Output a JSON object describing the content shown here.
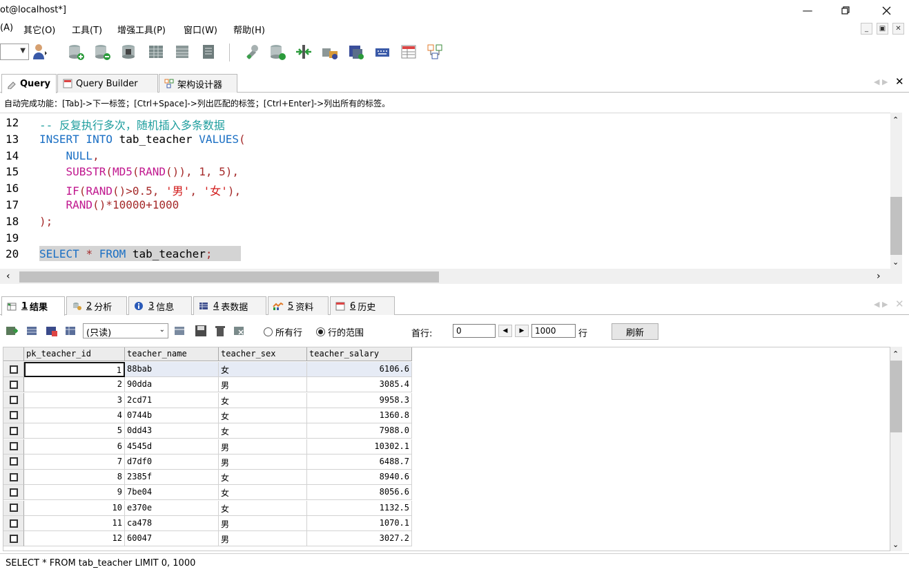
{
  "window": {
    "title": "ot@localhost*]"
  },
  "menu": [
    "(A)",
    "其它(O)",
    "工具(T)",
    "增强工具(P)",
    "窗口(W)",
    "帮助(H)"
  ],
  "query_tabs": [
    {
      "label": "Query",
      "icon": "query-icon"
    },
    {
      "label": "Query Builder",
      "icon": "query-builder-icon"
    },
    {
      "label": "架构设计器",
      "icon": "schema-designer-icon"
    }
  ],
  "hint": "自动完成功能：[Tab]->下一标签；[Ctrl+Space]->列出匹配的标签；[Ctrl+Enter]->列出所有的标签。",
  "editor": {
    "line_numbers": [
      "12",
      "13",
      "14",
      "15",
      "16",
      "17",
      "18",
      "19",
      "20"
    ],
    "lines": [
      [
        {
          "t": "-- 反复执行多次，随机插入多条数据",
          "c": "cmt"
        }
      ],
      [
        {
          "t": "INSERT INTO ",
          "c": "kw"
        },
        {
          "t": "tab_teacher ",
          "c": "plain"
        },
        {
          "t": "VALUES",
          "c": "kw"
        },
        {
          "t": "(",
          "c": "num"
        }
      ],
      [
        {
          "t": "    NULL",
          "c": "kw"
        },
        {
          "t": ",",
          "c": "num"
        }
      ],
      [
        {
          "t": "    SUBSTR",
          "c": "fn"
        },
        {
          "t": "(",
          "c": "num"
        },
        {
          "t": "MD5",
          "c": "fn"
        },
        {
          "t": "(",
          "c": "num"
        },
        {
          "t": "RAND",
          "c": "fn"
        },
        {
          "t": "()), 1, 5),",
          "c": "num"
        }
      ],
      [
        {
          "t": "    IF",
          "c": "fn"
        },
        {
          "t": "(",
          "c": "num"
        },
        {
          "t": "RAND",
          "c": "fn"
        },
        {
          "t": "()>0.5, ",
          "c": "num"
        },
        {
          "t": "'男'",
          "c": "str"
        },
        {
          "t": ", ",
          "c": "num"
        },
        {
          "t": "'女'",
          "c": "str"
        },
        {
          "t": "),",
          "c": "num"
        }
      ],
      [
        {
          "t": "    RAND",
          "c": "fn"
        },
        {
          "t": "()*10000+1000",
          "c": "num"
        }
      ],
      [
        {
          "t": ");",
          "c": "num"
        }
      ],
      [],
      [
        {
          "t": "SELECT ",
          "c": "kw"
        },
        {
          "t": "* ",
          "c": "num"
        },
        {
          "t": "FROM ",
          "c": "kw"
        },
        {
          "t": "tab_teacher",
          "c": "plain"
        },
        {
          "t": ";",
          "c": "num"
        }
      ]
    ]
  },
  "result_tabs": [
    {
      "num": "1",
      "label": "结果",
      "icon": "result-icon"
    },
    {
      "num": "2",
      "label": "分析",
      "icon": "profiler-icon"
    },
    {
      "num": "3",
      "label": "信息",
      "icon": "info-icon"
    },
    {
      "num": "4",
      "label": "表数据",
      "icon": "table-data-icon"
    },
    {
      "num": "5",
      "label": "资料",
      "icon": "data-icon"
    },
    {
      "num": "6",
      "label": "历史",
      "icon": "history-icon"
    }
  ],
  "result_toolbar": {
    "mode": "(只读)",
    "radio_all": "所有行",
    "radio_range": "行的范围",
    "first_row_label": "首行:",
    "first_row_value": "0",
    "row_count_value": "1000",
    "row_unit": "行",
    "refresh": "刷新"
  },
  "grid": {
    "columns": [
      "pk_teacher_id",
      "teacher_name",
      "teacher_sex",
      "teacher_salary"
    ],
    "rows": [
      [
        "1",
        "88bab",
        "女",
        "6106.6"
      ],
      [
        "2",
        "90dda",
        "男",
        "3085.4"
      ],
      [
        "3",
        "2cd71",
        "女",
        "9958.3"
      ],
      [
        "4",
        "0744b",
        "女",
        "1360.8"
      ],
      [
        "5",
        "0dd43",
        "女",
        "7988.0"
      ],
      [
        "6",
        "4545d",
        "男",
        "10302.1"
      ],
      [
        "7",
        "d7df0",
        "男",
        "6488.7"
      ],
      [
        "8",
        "2385f",
        "女",
        "8940.6"
      ],
      [
        "9",
        "7be04",
        "女",
        "8056.6"
      ],
      [
        "10",
        "e370e",
        "女",
        "1132.5"
      ],
      [
        "11",
        "ca478",
        "男",
        "1070.1"
      ],
      [
        "12",
        "60047",
        "男",
        "3027.2"
      ]
    ]
  },
  "status": "SELECT * FROM tab_teacher LIMIT 0, 1000"
}
